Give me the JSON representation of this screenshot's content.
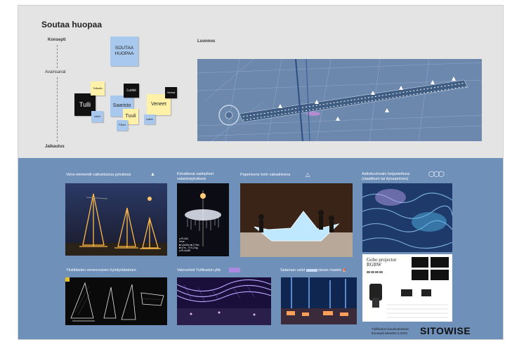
{
  "board": {
    "title": "Soutaa huopaa",
    "sections": {
      "konsepti": "Konsepti",
      "avainsanat": "Avainsanat",
      "jalkautus": "Jalkautus",
      "luonnos": "Luonnos"
    }
  },
  "stickies": [
    {
      "text": "SOUTAA HUOPAA",
      "color": "blue"
    },
    {
      "text": "Tulli",
      "color": "black"
    },
    {
      "text": "Tulliaalto",
      "color": "yellow"
    },
    {
      "text": "Saaristo",
      "color": "blue"
    },
    {
      "text": "Luotsi",
      "color": "black"
    },
    {
      "text": "Tuuli",
      "color": "yellow"
    },
    {
      "text": "Veneet",
      "color": "yellow"
    },
    {
      "text": "Verkot",
      "color": "black"
    },
    {
      "text": "Lasten",
      "color": "blue"
    },
    {
      "text": "Pilvet",
      "color": "blue"
    },
    {
      "text": "Aallot",
      "color": "blue"
    }
  ],
  "ideas": [
    {
      "caption": "Vene-elementit valkoiduissa pylväissä"
    },
    {
      "caption": "Kimaltavat sadepilvet valaisinpylväissä",
      "spec_lines": [
        "● PL344",
        "Vene",
        "■ 12x20m  ■ 2,70m",
        "■ 47m - 70 0,3 kg",
        "● PL444W"
      ]
    },
    {
      "caption": "Paperivene torin valoaiheena"
    },
    {
      "caption": "Aaltokuviovalo heijastettuna (staattinen tai dynaaminen)",
      "product_title": "Gobo projector RGBW"
    },
    {
      "caption": "Yksittäisten veneenosien hyödyntäminen"
    },
    {
      "caption": "Valoverkot Tullikadun yllä"
    },
    {
      "caption": "Sataman valot",
      "caption_end": "laivan mastot"
    }
  ],
  "footer": {
    "credit_line1": "Tullikadun kausivalaistus",
    "credit_line2": "konsepti-ideat30.3.2022",
    "logo": "SITOWISE"
  },
  "colors": {
    "top_bg": "#e4e4e4",
    "bottom_bg": "#6f90b9",
    "sticky_blue": "#a8c8ee",
    "sticky_yellow": "#fff2a8",
    "sticky_black": "#111111"
  }
}
